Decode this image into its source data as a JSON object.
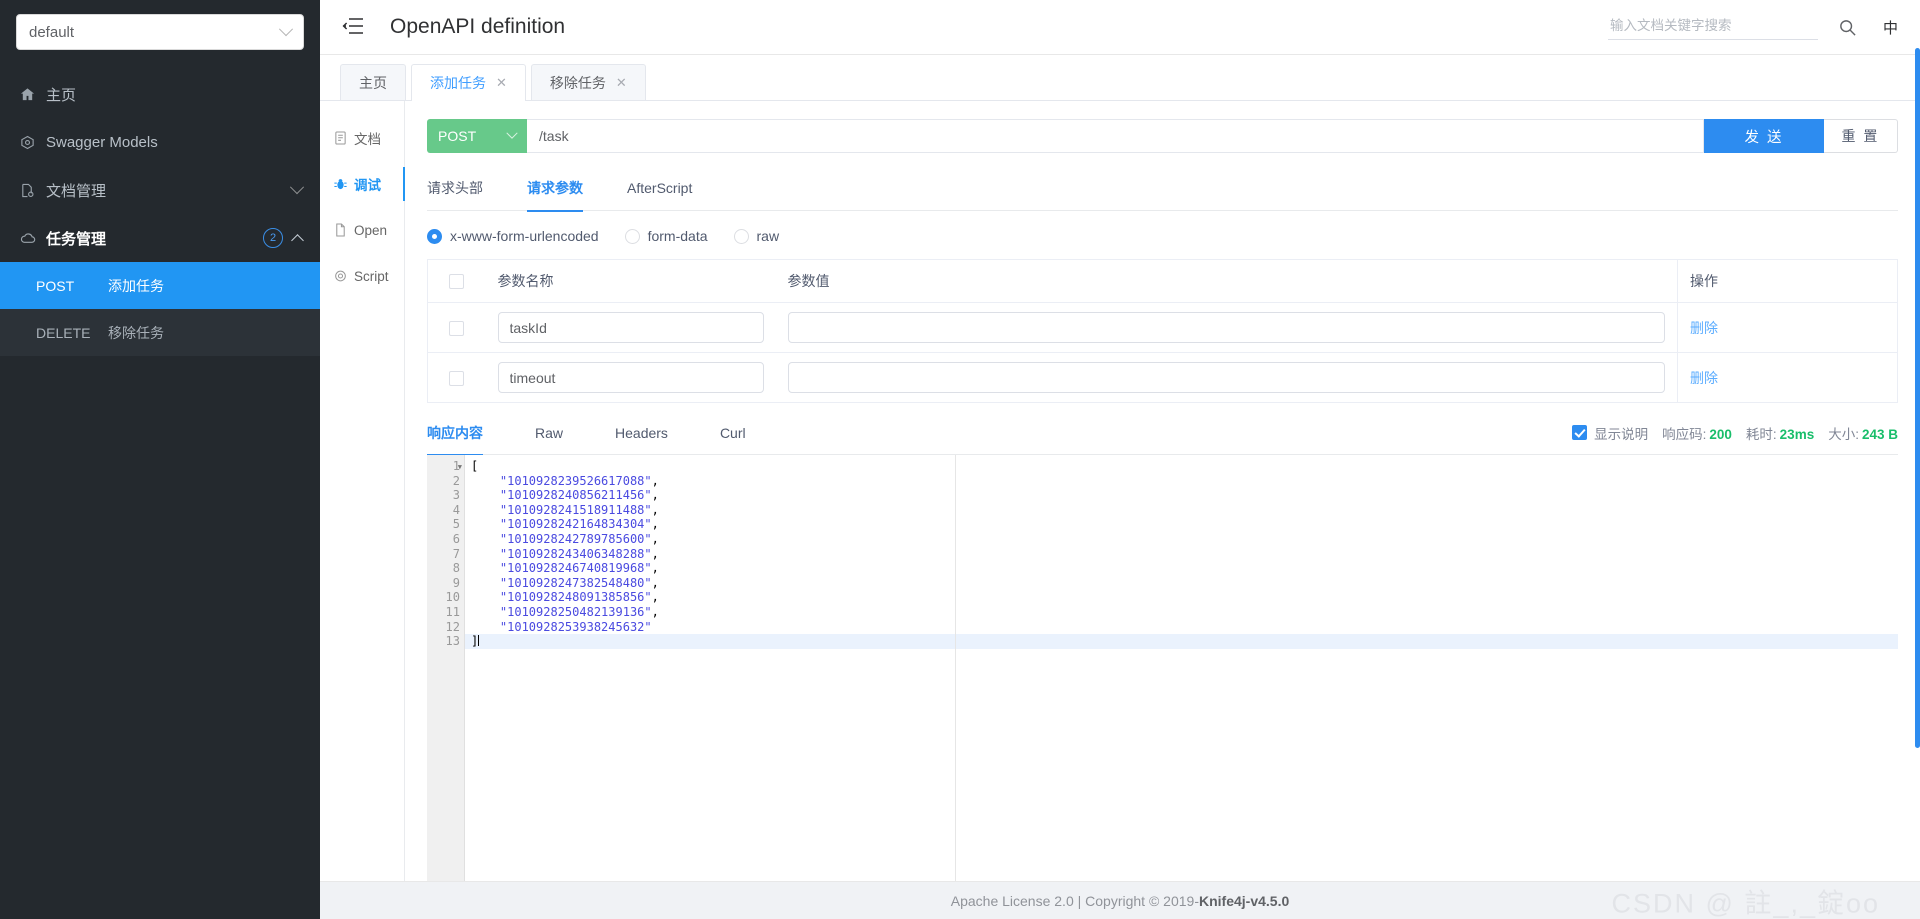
{
  "sidebar": {
    "select": {
      "value": "default",
      "icon": "chevron-down-icon"
    },
    "items": [
      {
        "label": "主页",
        "icon": "home-icon"
      },
      {
        "label": "Swagger Models",
        "icon": "models-icon"
      },
      {
        "label": "文档管理",
        "icon": "doc-manage-icon",
        "caret": "chevron-down-icon"
      },
      {
        "label": "任务管理",
        "icon": "cloud-icon",
        "badge": "2",
        "caret": "chevron-up-icon"
      }
    ],
    "sub_items": [
      {
        "method": "POST",
        "label": "添加任务",
        "selected": true
      },
      {
        "method": "DELETE",
        "label": "移除任务",
        "selected": false
      }
    ]
  },
  "topbar": {
    "menu_icon": "collapse-menu-icon",
    "title": "OpenAPI definition",
    "search_placeholder": "输入文档关键字搜索",
    "search_value": "",
    "search_icon": "search-icon",
    "lang_label": "中"
  },
  "tabs": [
    {
      "label": "主页",
      "closable": false,
      "active": false
    },
    {
      "label": "添加任务",
      "closable": true,
      "active": true
    },
    {
      "label": "移除任务",
      "closable": true,
      "active": false
    }
  ],
  "leftnav": [
    {
      "label": "文档",
      "icon": "document-icon",
      "active": false
    },
    {
      "label": "调试",
      "icon": "bug-icon",
      "active": true
    },
    {
      "label": "Open",
      "icon": "file-icon",
      "active": false
    },
    {
      "label": "Script",
      "icon": "script-icon",
      "active": false
    }
  ],
  "request": {
    "method": "POST",
    "method_chevron": "chevron-down-icon",
    "url": "/task",
    "url_placeholder": "",
    "send_label": "发 送",
    "reset_label": "重 置"
  },
  "request_tabs": [
    {
      "label": "请求头部",
      "active": false
    },
    {
      "label": "请求参数",
      "active": true
    },
    {
      "label": "AfterScript",
      "active": false
    }
  ],
  "body_type": [
    {
      "label": "x-www-form-urlencoded",
      "selected": true
    },
    {
      "label": "form-data",
      "selected": false
    },
    {
      "label": "raw",
      "selected": false
    }
  ],
  "params_table": {
    "headers": [
      "",
      "参数名称",
      "参数值",
      "操作"
    ],
    "rows": [
      {
        "checked": false,
        "name": "taskId",
        "value": "",
        "action": "删除"
      },
      {
        "checked": false,
        "name": "timeout",
        "value": "",
        "action": "删除"
      }
    ]
  },
  "response_tabs": [
    {
      "label": "响应内容",
      "active": true
    },
    {
      "label": "Raw",
      "active": false
    },
    {
      "label": "Headers",
      "active": false
    },
    {
      "label": "Curl",
      "active": false
    }
  ],
  "response_meta": {
    "show_desc_label": "显示说明",
    "show_desc_checked": true,
    "status_label": "响应码:",
    "status_value": "200",
    "time_label": "耗时:",
    "time_value": "23ms",
    "size_label": "大小:",
    "size_value": "243 B"
  },
  "response_body": {
    "lines": [
      {
        "n": "1",
        "text": "[",
        "fold": true
      },
      {
        "n": "2",
        "text": "    \"1010928239526617088\","
      },
      {
        "n": "3",
        "text": "    \"1010928240856211456\","
      },
      {
        "n": "4",
        "text": "    \"1010928241518911488\","
      },
      {
        "n": "5",
        "text": "    \"1010928242164834304\","
      },
      {
        "n": "6",
        "text": "    \"1010928242789785600\","
      },
      {
        "n": "7",
        "text": "    \"1010928243406348288\","
      },
      {
        "n": "8",
        "text": "    \"1010928246740819968\","
      },
      {
        "n": "9",
        "text": "    \"1010928247382548480\","
      },
      {
        "n": "10",
        "text": "    \"1010928248091385856\","
      },
      {
        "n": "11",
        "text": "    \"1010928250482139136\","
      },
      {
        "n": "12",
        "text": "    \"1010928253938245632\""
      },
      {
        "n": "13",
        "text": "]",
        "current": true
      }
    ]
  },
  "footer": {
    "text_prefix": "Apache License 2.0 | Copyright ",
    "copyright_glyph": "©",
    "text_suffix": " 2019-",
    "version": "Knife4j-v4.5.0",
    "watermark": "CSDN @  註_,_錠oo"
  },
  "colors": {
    "accent": "#2d8cf0",
    "sidebar_bg": "#24292e",
    "method_post": "#67c98a",
    "success": "#19be6b"
  }
}
